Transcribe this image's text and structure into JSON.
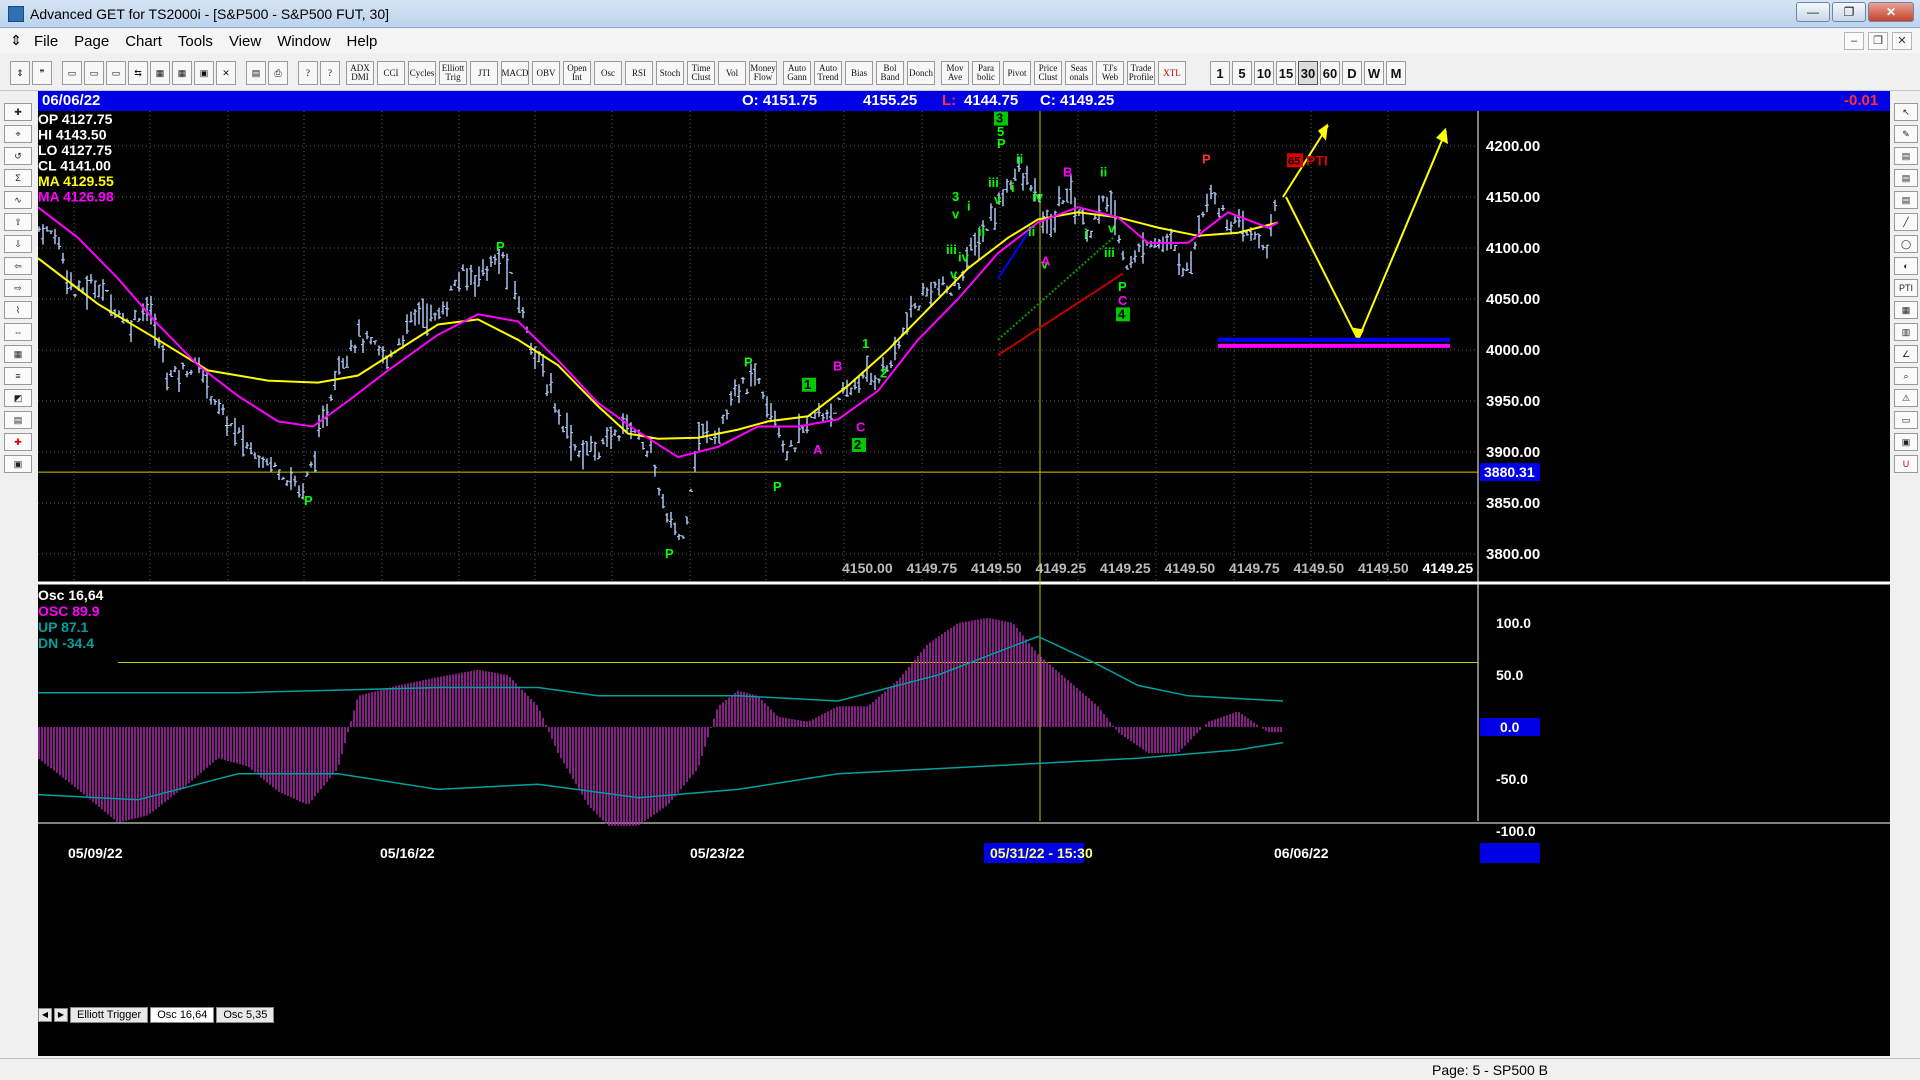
{
  "window": {
    "title": "Advanced GET for TS2000i - [S&P500 - S&P500 FUT, 30]",
    "minimize": "—",
    "maximize": "❐",
    "close": "✕"
  },
  "menu": [
    "File",
    "Page",
    "Chart",
    "Tools",
    "View",
    "Window",
    "Help"
  ],
  "toolbar": {
    "studies": [
      "ADX DMI",
      "CCI",
      "Cycles",
      "Elliott Trig",
      "JTI",
      "MACD",
      "OBV",
      "Open Int",
      "Osc",
      "RSI",
      "Stoch",
      "Time Clust",
      "Vol",
      "Money Flow",
      "Auto Gann",
      "Auto Trend",
      "Bias",
      "Bol Band",
      "Donch",
      "Mov Ave",
      "Para bolic",
      "Pivot",
      "Price Clust",
      "Seas onals",
      "TJ's Web",
      "Trade Profile",
      "XTL"
    ],
    "intervals": [
      "1",
      "5",
      "10",
      "15",
      "30",
      "60",
      "D",
      "W",
      "M"
    ],
    "active_interval": "30"
  },
  "info_bar": {
    "date": "06/06/22",
    "open": "O: 4151.75",
    "high": "4155.25",
    "low_label": "L:",
    "low": "4144.75",
    "close": "C: 4149.25",
    "change": "-0.01"
  },
  "legend": {
    "op": "OP  4127.75",
    "hi": "HI   4143.50",
    "lo": "LO  4127.75",
    "cl": "CL  4141.00",
    "ma_yellow": "MA  4129.55",
    "ma_magenta": "MA  4126.98"
  },
  "price_axis": [
    "4200.00",
    "4150.00",
    "4100.00",
    "4050.00",
    "4000.00",
    "3950.00",
    "3900.00",
    "3850.00",
    "3800.00"
  ],
  "price_marker": "3880.31",
  "bottom_prices": [
    "4150.00",
    "4149.75",
    "4149.50",
    "4149.25",
    "4149.25",
    "4149.50",
    "4149.75",
    "4149.50",
    "4149.50",
    "4149.25"
  ],
  "wave_labels": {
    "p": "P",
    "a": "A",
    "b": "B",
    "c": "C",
    "one": "1",
    "two": "2",
    "three": "3",
    "four": "4",
    "five": "5",
    "i": "i",
    "ii": "ii",
    "iii": "iii",
    "iv": "iv",
    "v": "v",
    "pti": "PTI",
    "pti_val": "65"
  },
  "oscillator": {
    "title": "Osc 16,64",
    "osc": "OSC  89.9",
    "up": "UP    87.1",
    "dn": "DN   -34.4",
    "axis": [
      "100.0",
      "50.0",
      "0.0",
      "-50.0",
      "-100.0"
    ],
    "zero_marker": "0.0"
  },
  "tabs": [
    "Elliott Trigger",
    "Osc 16,64",
    "Osc 5,35"
  ],
  "active_tab": "Osc 16,64",
  "date_axis": [
    "05/09/22",
    "05/16/22",
    "05/23/22",
    "05/31/22 - 15:30",
    "06/06/22"
  ],
  "status": "Page: 5 - SP500 B",
  "colors": {
    "background": "#000000",
    "price_bars": "#b4d2ff",
    "ma_fast": "#ffff00",
    "ma_slow": "#ff00ff",
    "wave_green": "#00ff00",
    "wave_magenta": "#ff00ff",
    "header_blue": "#0000e6"
  }
}
